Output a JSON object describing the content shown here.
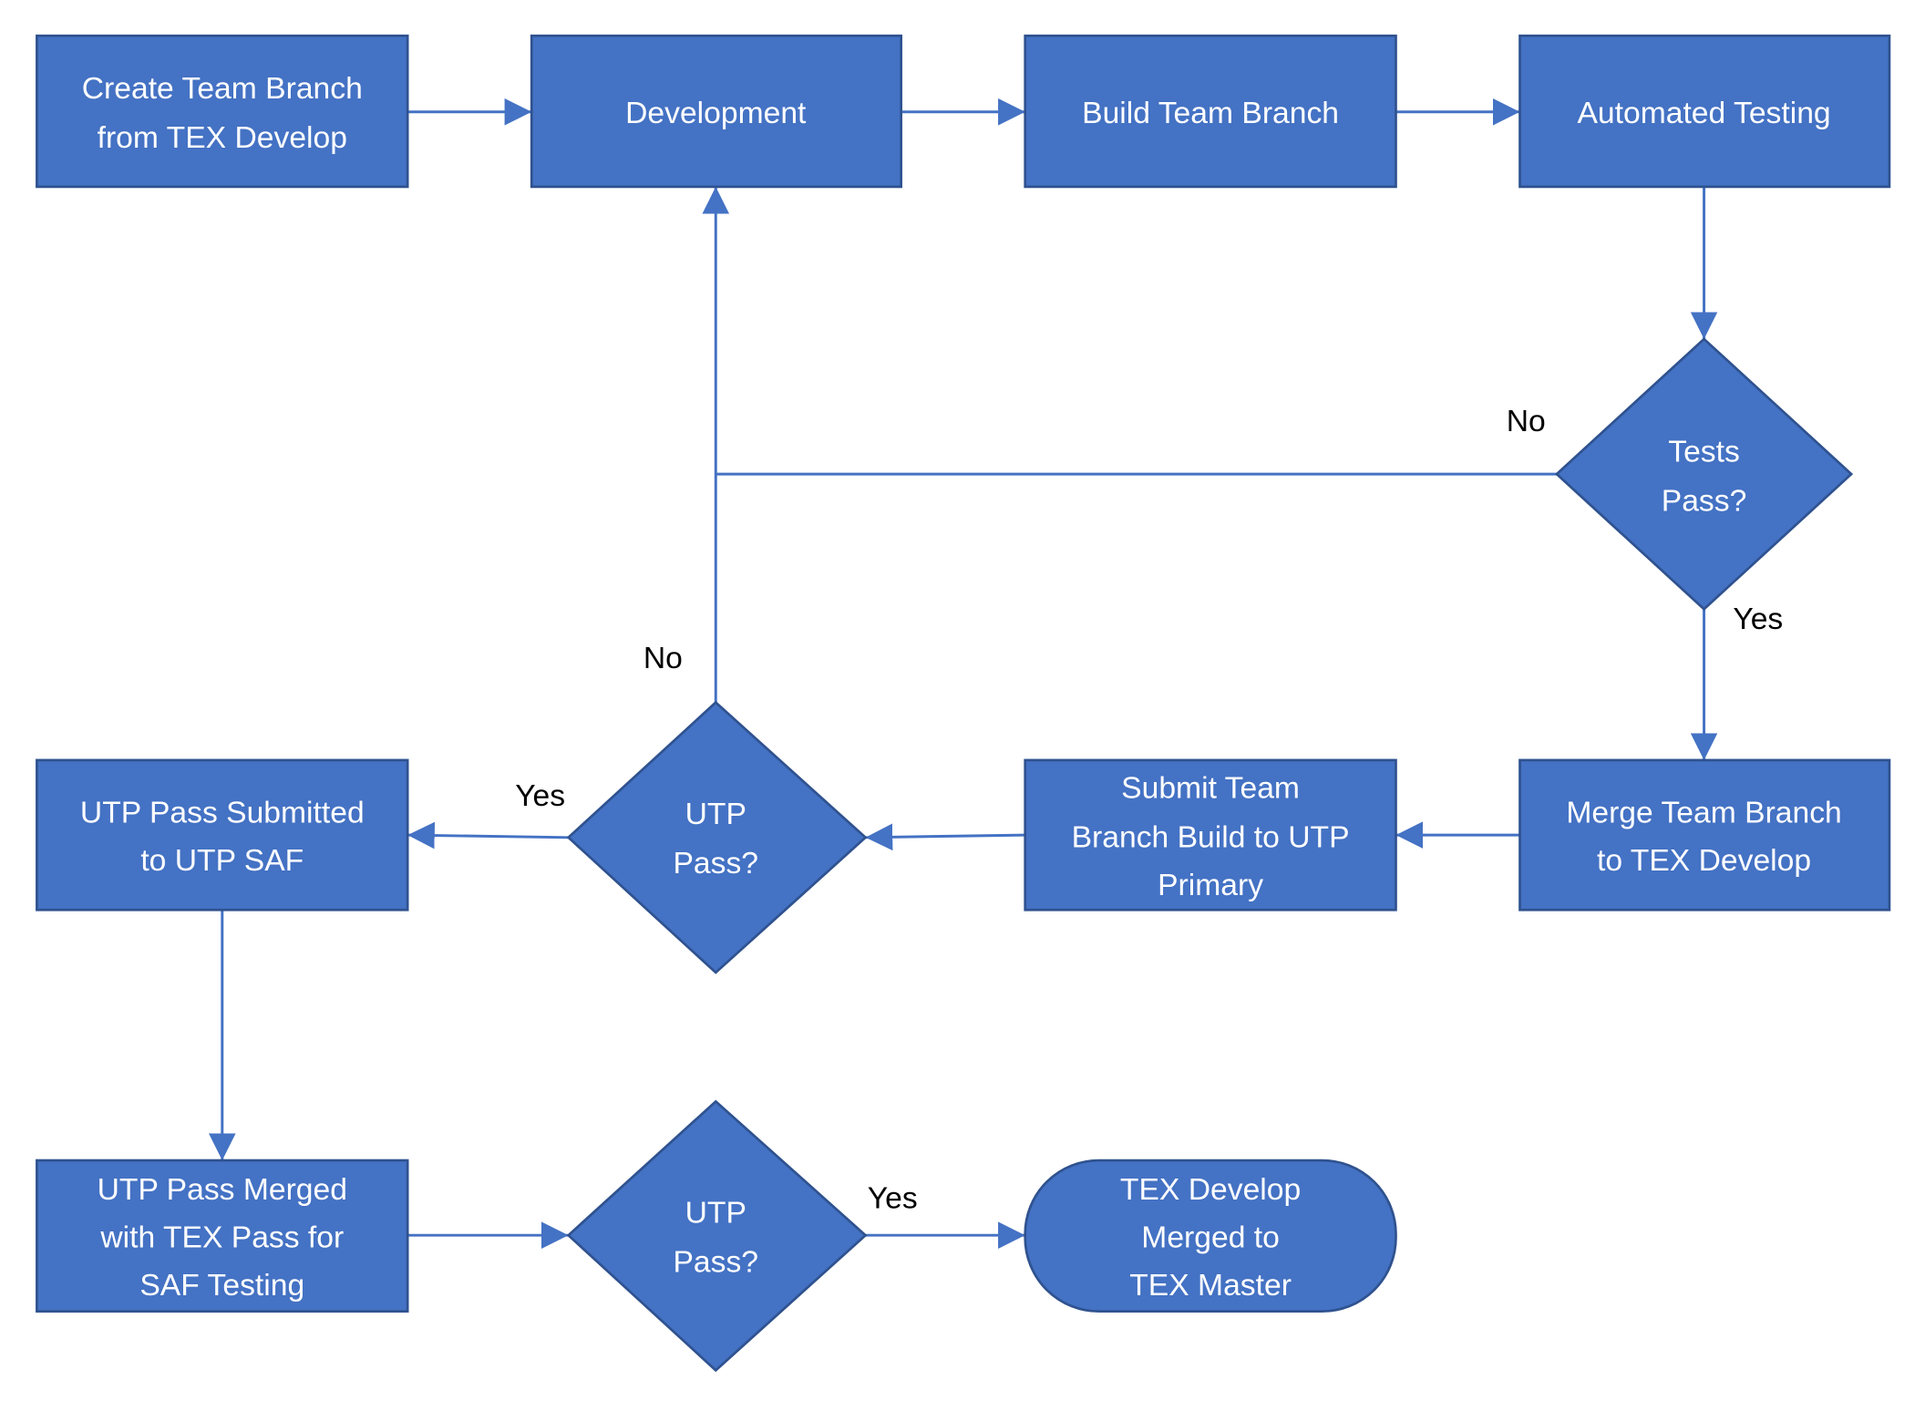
{
  "colors": {
    "node_fill": "#4472C4",
    "node_stroke": "#2F528F",
    "edge": "#4472C4",
    "label": "#000000"
  },
  "nodes": {
    "create_branch": {
      "shape": "process",
      "lines": [
        "Create Team Branch",
        "from TEX Develop"
      ]
    },
    "development": {
      "shape": "process",
      "lines": [
        "Development"
      ]
    },
    "build_branch": {
      "shape": "process",
      "lines": [
        "Build Team Branch"
      ]
    },
    "automated_testing": {
      "shape": "process",
      "lines": [
        "Automated Testing"
      ]
    },
    "tests_pass": {
      "shape": "decision",
      "lines": [
        "Tests",
        "Pass?"
      ]
    },
    "merge_branch": {
      "shape": "process",
      "lines": [
        "Merge Team Branch",
        "to TEX Develop"
      ]
    },
    "submit_build": {
      "shape": "process",
      "lines": [
        "Submit Team",
        "Branch Build to UTP",
        "Primary"
      ]
    },
    "utp_pass_1": {
      "shape": "decision",
      "lines": [
        "UTP",
        "Pass?"
      ]
    },
    "utp_submitted": {
      "shape": "process",
      "lines": [
        "UTP Pass Submitted",
        "to UTP SAF"
      ]
    },
    "utp_merged": {
      "shape": "process",
      "lines": [
        "UTP Pass Merged",
        "with TEX Pass for",
        "SAF Testing"
      ]
    },
    "utp_pass_2": {
      "shape": "decision",
      "lines": [
        "UTP",
        "Pass?"
      ]
    },
    "tex_master": {
      "shape": "terminal",
      "lines": [
        "TEX Develop",
        "Merged to",
        "TEX Master"
      ]
    }
  },
  "edge_labels": {
    "tests_no": "No",
    "tests_yes": "Yes",
    "utp1_no": "No",
    "utp1_yes": "Yes",
    "utp2_yes": "Yes"
  }
}
